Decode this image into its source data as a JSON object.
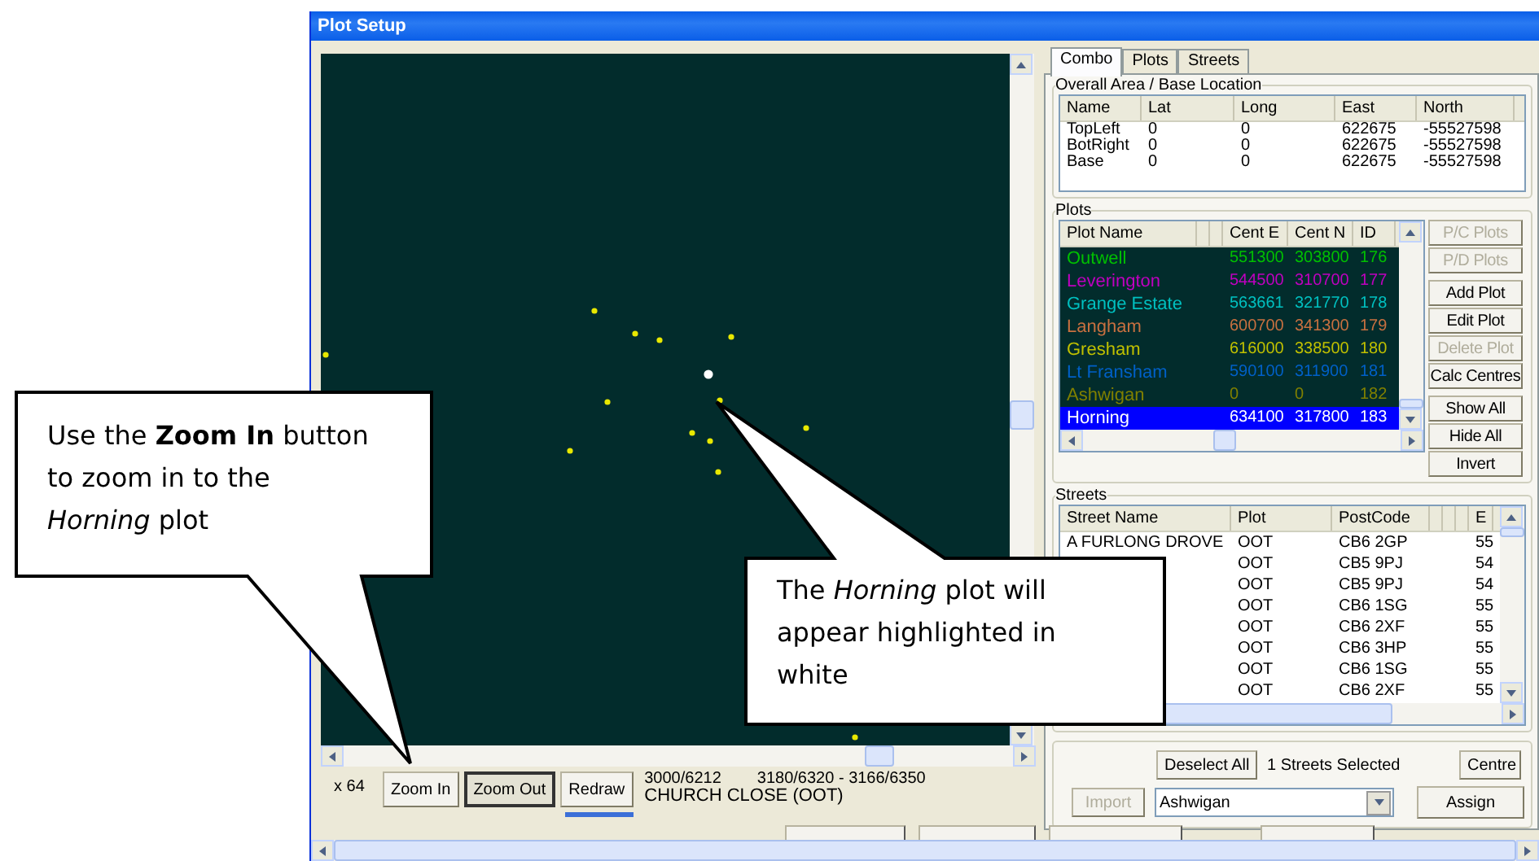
{
  "window": {
    "title": "Plot Setup"
  },
  "map": {
    "scale": "x 64"
  },
  "map_buttons": [
    {
      "label": "Zoom In",
      "pressed": false
    },
    {
      "label": "Zoom Out",
      "pressed": true
    },
    {
      "label": "Redraw",
      "pressed": false
    }
  ],
  "status": {
    "line_1a": "3000/6212",
    "line_1b": "3180/6320 - 3166/6350",
    "line_2": "CHURCH CLOSE (OOT)"
  },
  "tabs": [
    {
      "label": "Combo",
      "selected": true
    },
    {
      "label": "Plots",
      "selected": false
    },
    {
      "label": "Streets",
      "selected": false
    }
  ],
  "overall": {
    "title": "Overall Area / Base Location",
    "columns": [
      "Name",
      "Lat",
      "Long",
      "East",
      "North"
    ],
    "rows": [
      [
        "TopLeft",
        "0",
        "0",
        "622675",
        "-55527598"
      ],
      [
        "BotRight",
        "0",
        "0",
        "622675",
        "-55527598"
      ],
      [
        "Base",
        "0",
        "0",
        "622675",
        "-55527598"
      ]
    ]
  },
  "plots": {
    "title": "Plots",
    "columns": [
      "Plot Name",
      "Cent E",
      "Cent N",
      "ID"
    ],
    "rows": [
      {
        "name": "Outwell",
        "cent_e": "551300",
        "cent_n": "303800",
        "id": "176",
        "color": "#00c000",
        "selected": false
      },
      {
        "name": "Leverington",
        "cent_e": "544500",
        "cent_n": "310700",
        "id": "177",
        "color": "#c000c0",
        "selected": false
      },
      {
        "name": "Grange Estate",
        "cent_e": "563661",
        "cent_n": "321770",
        "id": "178",
        "color": "#00c0c0",
        "selected": false
      },
      {
        "name": "Langham",
        "cent_e": "600700",
        "cent_n": "341300",
        "id": "179",
        "color": "#c87040",
        "selected": false
      },
      {
        "name": "Gresham",
        "cent_e": "616000",
        "cent_n": "338500",
        "id": "180",
        "color": "#c0c000",
        "selected": false
      },
      {
        "name": "Lt Fransham",
        "cent_e": "590100",
        "cent_n": "311900",
        "id": "181",
        "color": "#0060c8",
        "selected": false
      },
      {
        "name": "Ashwigan",
        "cent_e": "0",
        "cent_n": "0",
        "id": "182",
        "color": "#808000",
        "selected": false
      },
      {
        "name": "Horning",
        "cent_e": "634100",
        "cent_n": "317800",
        "id": "183",
        "color": "#ffffff",
        "selected": true
      }
    ]
  },
  "plot_buttons": [
    {
      "label": "P/C Plots",
      "disabled": true
    },
    {
      "label": "P/D Plots",
      "disabled": true
    },
    {
      "label": "Add Plot",
      "disabled": false
    },
    {
      "label": "Edit Plot",
      "disabled": false
    },
    {
      "label": "Delete Plot",
      "disabled": true
    },
    {
      "label": "Calc Centres",
      "disabled": false
    },
    {
      "label": "Show All",
      "disabled": false
    },
    {
      "label": "Hide All",
      "disabled": false
    },
    {
      "label": "Invert",
      "disabled": false
    }
  ],
  "streets": {
    "title": "Streets",
    "columns": [
      "Street Name",
      "Plot",
      "PostCode",
      "E"
    ],
    "rows": [
      {
        "street_name": "A FURLONG DROVE",
        "plot": "OOT",
        "postcode": "CB6 2GP",
        "east": "55"
      },
      {
        "plot": "OOT",
        "postcode": "CB5 9PJ",
        "east": "54"
      },
      {
        "plot": "OOT",
        "postcode": "CB5 9PJ",
        "east": "54"
      },
      {
        "plot": "OOT",
        "postcode": "CB6 1SG",
        "east": "55"
      },
      {
        "plot": "OOT",
        "postcode": "CB6 2XF",
        "east": "55"
      },
      {
        "plot": "OOT",
        "postcode": "CB6 3HP",
        "east": "55"
      },
      {
        "plot": "OOT",
        "postcode": "CB6 1SG",
        "east": "55"
      },
      {
        "plot": "OOT",
        "postcode": "CB6 2XF",
        "east": "55"
      }
    ]
  },
  "selection": {
    "deselect": "Deselect All",
    "count": "1 Streets Selected",
    "centre": "Centre",
    "import": {
      "label": "Import",
      "disabled": true
    },
    "plot_combo": "Ashwigan",
    "assign": "Assign"
  },
  "callouts": [
    {
      "text": "Use the **Zoom In** button to zoom in to the *Horning* plot"
    },
    {
      "text": "The *Horning* plot will appear highlighted in white"
    }
  ]
}
